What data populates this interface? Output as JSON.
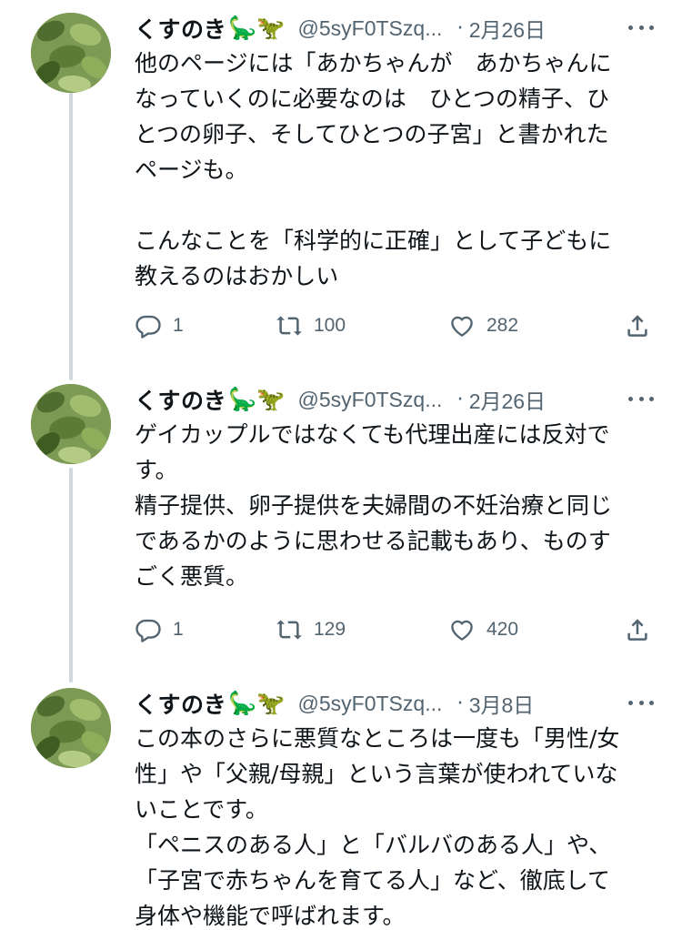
{
  "tweets": [
    {
      "author_name": "くすのき",
      "author_emoji": "🦕🦖",
      "handle": "@5syF0TSzq...",
      "separator": "·",
      "date": "2月26日",
      "text": "他のページには「あかちゃんが　あかちゃんに\nなっていくのに必要なのは　ひとつの精子、ひ\nとつの卵子、そしてひとつの子宮」と書かれた\nページも。\n\nこんなことを「科学的に正確」として子どもに\n教えるのはおかしい",
      "replies": "1",
      "reposts": "100",
      "likes": "282"
    },
    {
      "author_name": "くすのき",
      "author_emoji": "🦕🦖",
      "handle": "@5syF0TSzq...",
      "separator": "·",
      "date": "2月26日",
      "text": "ゲイカップルではなくても代理出産には反対で\nす。\n精子提供、卵子提供を夫婦間の不妊治療と同じ\nであるかのように思わせる記載もあり、ものす\nごく悪質。",
      "replies": "1",
      "reposts": "129",
      "likes": "420"
    },
    {
      "author_name": "くすのき",
      "author_emoji": "🦕🦖",
      "handle": "@5syF0TSzq...",
      "separator": "·",
      "date": "3月8日",
      "text": "この本のさらに悪質なところは一度も「男性/女\n性」や「父親/母親」という言葉が使われていな\nいことです。\n「ペニスのある人」と「バルバのある人」や、\n「子宮で赤ちゃんを育てる人」など、徹底して\n身体や機能で呼ばれます。"
    }
  ],
  "icons": {
    "reply": "reply-icon",
    "repost": "repost-icon",
    "like": "heart-icon",
    "share": "share-icon",
    "more": "more-icon"
  },
  "colors": {
    "text": "#0f1419",
    "secondary": "#536471",
    "thread_line": "#cfd9de"
  }
}
